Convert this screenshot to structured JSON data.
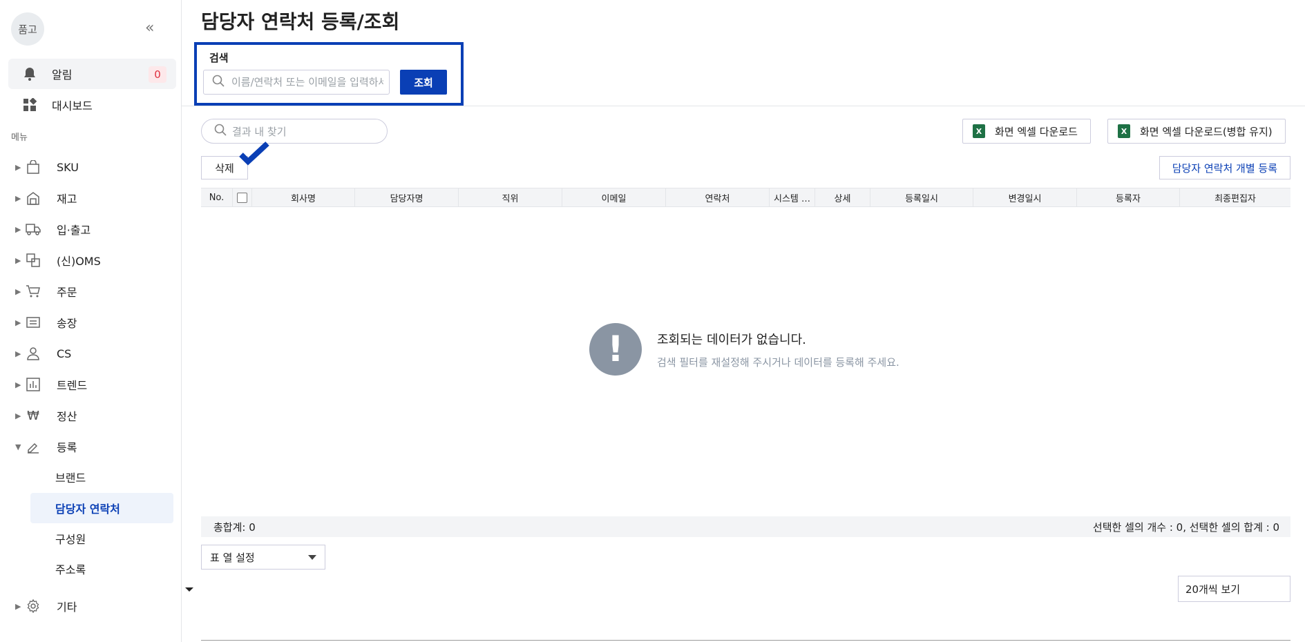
{
  "sidebar": {
    "logo": "품고",
    "alarm": {
      "label": "알림",
      "count": "0"
    },
    "dashboard": "대시보드",
    "menu_title": "메뉴",
    "menu": [
      {
        "label": "SKU",
        "icon": "bag-icon"
      },
      {
        "label": "재고",
        "icon": "warehouse-icon"
      },
      {
        "label": "입·출고",
        "icon": "truck-icon"
      },
      {
        "label": "(신)OMS",
        "icon": "oms-icon"
      },
      {
        "label": "주문",
        "icon": "cart-icon"
      },
      {
        "label": "송장",
        "icon": "invoice-icon"
      },
      {
        "label": "CS",
        "icon": "person-icon"
      },
      {
        "label": "트렌드",
        "icon": "chart-icon"
      },
      {
        "label": "정산",
        "icon": "won-icon"
      },
      {
        "label": "등록",
        "icon": "pencil-icon"
      }
    ],
    "submenu": [
      "브랜드",
      "담당자 연락처",
      "구성원",
      "주소록"
    ],
    "etc": "기타"
  },
  "page": {
    "title": "담당자 연락처 등록/조회"
  },
  "search": {
    "label": "검색",
    "placeholder": "이름/연락처 또는 이메일을 입력하세요",
    "button": "조회"
  },
  "toolbar": {
    "result_find_placeholder": "결과 내 찾기",
    "excel_download": "화면 엑셀 다운로드",
    "excel_download_merge": "화면 엑셀 다운로드(병합 유지)",
    "delete": "삭제",
    "register": "담당자 연락처 개별 등록"
  },
  "table": {
    "columns": [
      "No.",
      "",
      "회사명",
      "담당자명",
      "직위",
      "이메일",
      "연락처",
      "시스템 …",
      "상세",
      "등록일시",
      "변경일시",
      "등록자",
      "최종편집자"
    ]
  },
  "empty": {
    "title": "조회되는 데이터가 없습니다.",
    "desc": "검색 필터를 재설정해 주시거나 데이터를 등록해 주세요."
  },
  "footer": {
    "total": "총합계: 0",
    "selection": "선택한 셀의 개수 : 0, 선택한 셀의 합계 : 0",
    "column_setting": "표 열 설정",
    "page_size": "20개씩 보기"
  }
}
